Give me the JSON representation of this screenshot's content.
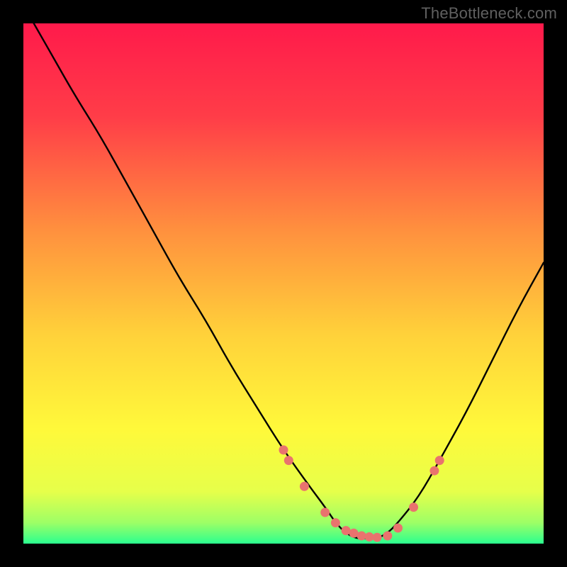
{
  "watermark": "TheBottleneck.com",
  "gradient": {
    "stops": [
      {
        "pct": 0,
        "color": "#ff1a4b"
      },
      {
        "pct": 18,
        "color": "#ff3d48"
      },
      {
        "pct": 40,
        "color": "#ff913e"
      },
      {
        "pct": 60,
        "color": "#ffd23a"
      },
      {
        "pct": 78,
        "color": "#fff93a"
      },
      {
        "pct": 90,
        "color": "#e6ff4a"
      },
      {
        "pct": 96,
        "color": "#9dff66"
      },
      {
        "pct": 100,
        "color": "#2bff8f"
      }
    ]
  },
  "chart_data": {
    "type": "line",
    "title": "",
    "xlabel": "",
    "ylabel": "",
    "xlim": [
      0,
      100
    ],
    "ylim": [
      0,
      100
    ],
    "series": [
      {
        "name": "bottleneck-curve",
        "x": [
          2,
          6,
          10,
          15,
          20,
          25,
          30,
          35,
          40,
          45,
          50,
          55,
          58,
          60,
          62,
          64,
          66,
          68,
          70,
          72,
          76,
          80,
          85,
          90,
          95,
          100
        ],
        "y": [
          100,
          93,
          86,
          78,
          69,
          60,
          51,
          43,
          34,
          26,
          18,
          11,
          7,
          4,
          2,
          1,
          1,
          1,
          2,
          4,
          9,
          16,
          25,
          35,
          45,
          54
        ]
      }
    ],
    "markers": {
      "name": "highlight-dots",
      "color": "#e9736e",
      "x": [
        50,
        51,
        54,
        58,
        60,
        62,
        63.5,
        65,
        66.5,
        68,
        70,
        72,
        75,
        79,
        80
      ],
      "y": [
        18,
        16,
        11,
        6,
        4,
        2.5,
        2,
        1.5,
        1.3,
        1.2,
        1.5,
        3,
        7,
        14,
        16
      ]
    }
  }
}
